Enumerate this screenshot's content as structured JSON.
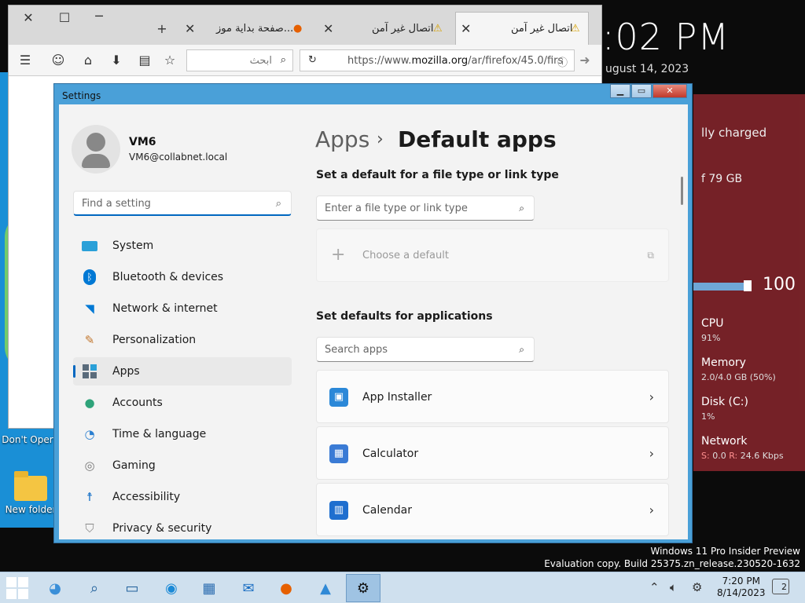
{
  "browser": {
    "tabs": [
      {
        "title": "اتصال غير آمن",
        "active": true
      },
      {
        "title": "اتصال غير آمن",
        "active": false
      },
      {
        "title": "صفحة بداية موز...",
        "active": false
      }
    ],
    "search_placeholder": "ابحث",
    "url_prefix": "https://www.",
    "url_host": "mozilla.org",
    "url_path": "/ar/firefox/45.0/firs"
  },
  "desktop": {
    "clock": ":02 PM",
    "date": "ugust 14, 2023",
    "overlay": {
      "charged": "lly charged",
      "storage": "f 79 GB",
      "volume": "100",
      "cpu_label": "CPU",
      "cpu_value": "91%",
      "mem_label": "Memory",
      "mem_value": "2.0/4.0 GB (50%)",
      "disk_label": "Disk (C:)",
      "disk_value": "1%",
      "net_label": "Network",
      "net_s": "S:",
      "net_s_value": "0.0",
      "net_r": "R:",
      "net_r_value": "24.6 Kbps"
    },
    "icons": [
      {
        "label": "Don't Oper"
      },
      {
        "label": "New folder"
      }
    ],
    "watermark_line1": "Windows 11 Pro Insider Preview",
    "watermark_line2": "Evaluation copy. Build 25375.zn_release.230520-1632"
  },
  "settings": {
    "window_title": "Settings",
    "user": {
      "name": "VM6",
      "email": "VM6@collabnet.local"
    },
    "find_placeholder": "Find a setting",
    "nav": [
      {
        "label": "System",
        "icon": "system-icon"
      },
      {
        "label": "Bluetooth & devices",
        "icon": "bluetooth-icon"
      },
      {
        "label": "Network & internet",
        "icon": "wifi-icon"
      },
      {
        "label": "Personalization",
        "icon": "brush-icon"
      },
      {
        "label": "Apps",
        "icon": "apps-icon",
        "selected": true
      },
      {
        "label": "Accounts",
        "icon": "accounts-icon"
      },
      {
        "label": "Time & language",
        "icon": "globe-icon"
      },
      {
        "label": "Gaming",
        "icon": "gamepad-icon"
      },
      {
        "label": "Accessibility",
        "icon": "accessibility-icon"
      },
      {
        "label": "Privacy & security",
        "icon": "shield-icon"
      }
    ],
    "breadcrumb_parent": "Apps",
    "breadcrumb_current": "Default apps",
    "filetype_heading": "Set a default for a file type or link type",
    "filetype_placeholder": "Enter a file type or link type",
    "choose_default": "Choose a default",
    "apps_heading": "Set defaults for applications",
    "apps_search_placeholder": "Search apps",
    "apps": [
      {
        "name": "App Installer",
        "color": "#2b88d8"
      },
      {
        "name": "Calculator",
        "color": "#3a7bd5"
      },
      {
        "name": "Calendar",
        "color": "#1f6fcf"
      }
    ]
  },
  "taskbar": {
    "time": "7:20 PM",
    "date": "8/14/2023",
    "notifications": "2"
  }
}
